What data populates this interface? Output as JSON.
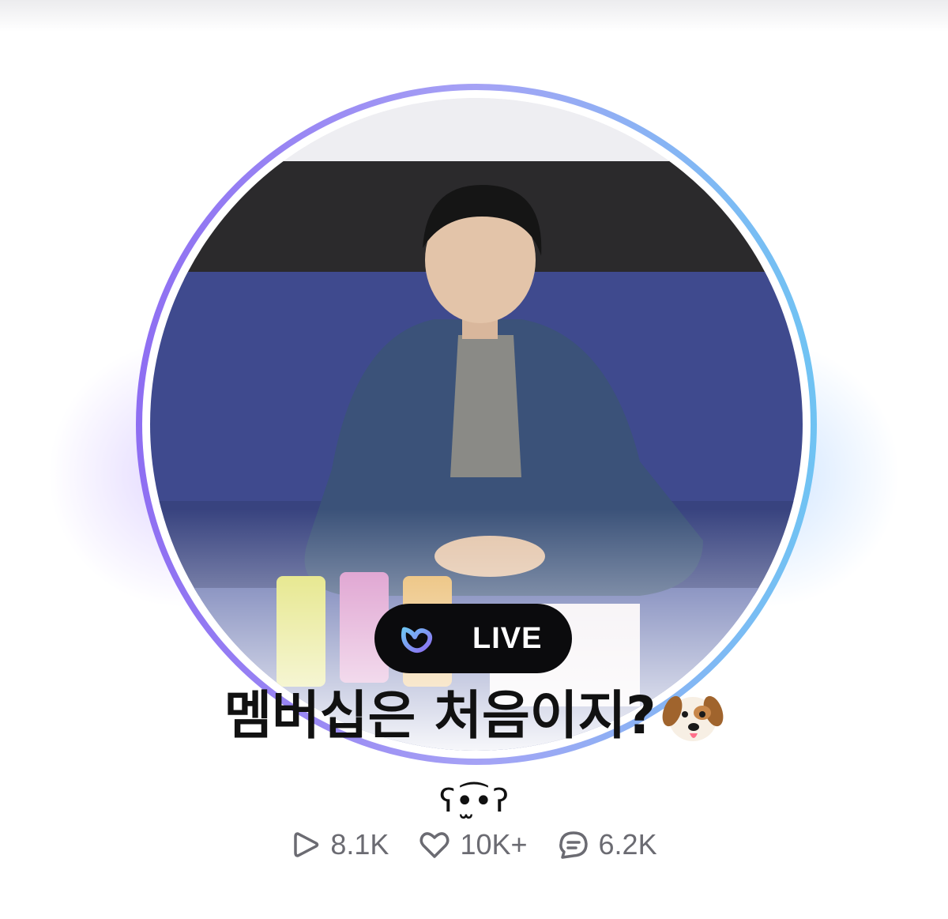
{
  "live": {
    "badge_label": "LIVE"
  },
  "broadcast": {
    "title": "멤버십은 처음이지?",
    "title_emoji": "dog-face-icon",
    "subtitle": "ʕ•̫͡•ʔ"
  },
  "stats": {
    "plays": "8.1K",
    "likes": "10K+",
    "comments": "6.2K"
  },
  "icons": {
    "play": "play-icon",
    "like": "heart-icon",
    "comment": "comment-icon",
    "brand": "weverse-logo-icon"
  },
  "colors": {
    "ring_start": "#8e6ef2",
    "ring_end": "#6fc3f3",
    "badge_bg": "#0b0b0d",
    "stat_text": "#6b6b72"
  }
}
